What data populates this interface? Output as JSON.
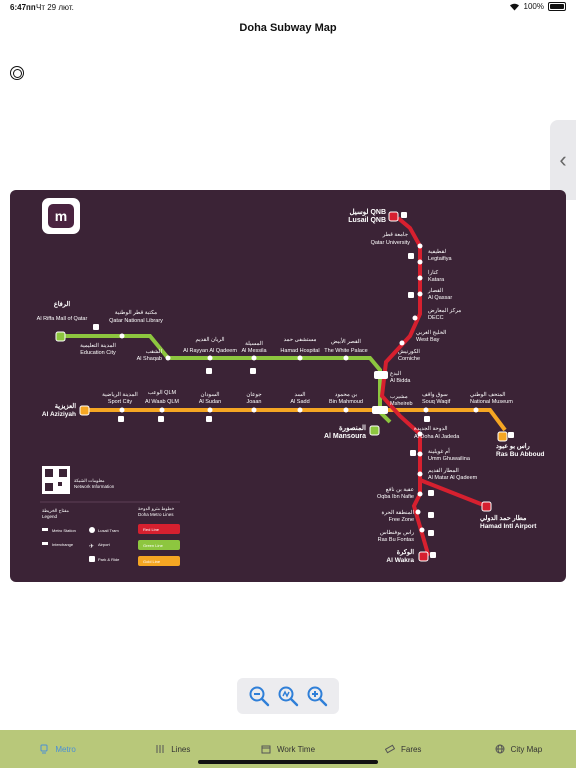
{
  "status": {
    "time": "6:47пп",
    "date": "Чт 29 лют.",
    "battery": "100%"
  },
  "header": {
    "title": "Doha Subway Map"
  },
  "side_tab": {
    "icon": "chevron-left-icon",
    "glyph": "‹"
  },
  "map": {
    "colors": {
      "background": "#3b2336",
      "red_line": "#d6202f",
      "green_line": "#8dc63f",
      "gold_line": "#f5a623",
      "station": "#ffffff"
    },
    "stations": {
      "lusail": "Lusail QNB",
      "lusail_ar": "لوسيل QNB",
      "qatar_university": "Qatar University",
      "qatar_university_ar": "جامعة قطر",
      "legtaifiya": "Legtaifiya",
      "legtaifiya_ar": "لقطيفية",
      "katara": "Katara",
      "katara_ar": "كتارا",
      "qassar": "Al Qassar",
      "qassar_ar": "القصار",
      "decc": "DECC",
      "decc_ar": "مركز المعارض",
      "west_bay": "West Bay",
      "west_bay_ar": "الخليج الغربي",
      "corniche": "Corniche",
      "corniche_ar": "الكورنيش",
      "al_bidda": "Al Bidda",
      "al_bidda_ar": "البدع",
      "msheireb": "Msheireb",
      "msheireb_ar": "مشيرب",
      "souq_waqif": "Souq Waqif",
      "souq_waqif_ar": "سوق واقف",
      "national_museum": "National Museum",
      "national_museum_ar": "المتحف الوطني",
      "ras_bu_abboud": "Ras Bu Abboud",
      "ras_bu_abboud_ar": "راس بو عبود",
      "al_doha_al_jadeda": "Al Doha Al Jadeda",
      "al_doha_al_jadeda_ar": "الدوحة الجديدة",
      "umm_ghuwailina": "Umm Ghuwailina",
      "umm_ghuwailina_ar": "أم غويلينة",
      "matar_qadeem": "Al Matar Al Qadeem",
      "matar_qadeem_ar": "المطار القديم",
      "oqba_ibn_nafie": "Oqba Ibn Nafie",
      "oqba_ibn_nafie_ar": "عقبة بن نافع",
      "free_zone": "Free Zone",
      "free_zone_ar": "المنطقة الحرة",
      "ras_bu_fontas": "Ras Bu Fontas",
      "ras_bu_fontas_ar": "راس بوفنطاس",
      "al_wakra": "Al Wakra",
      "al_wakra_ar": "الوكرة",
      "airport": "Hamad Intl Airport",
      "airport_ar": "مطار حمد الدولي",
      "al_mansoura": "Al Mansoura",
      "al_mansoura_ar": "المنصورة",
      "bin_mahmoud": "Bin Mahmoud",
      "bin_mahmoud_ar": "بن محمود",
      "al_sadd": "Al Sadd",
      "al_sadd_ar": "السد",
      "joaan": "Joaan",
      "joaan_ar": "جوعان",
      "al_sudan": "Al Sudan",
      "al_sudan_ar": "السودان",
      "al_waab": "Al Waab QLM",
      "al_waab_ar": "الوعب QLM",
      "sport_city": "Sport City",
      "sport_city_ar": "المدينة الرياضية",
      "al_aziziyah": "Al Aziziyah",
      "al_aziziyah_ar": "العزيزية",
      "the_white_palace": "The White Palace",
      "the_white_palace_ar": "القصر الأبيض",
      "hamad_hospital": "Hamad Hospital",
      "hamad_hospital_ar": "مستشفى حمد",
      "al_messila": "Al Messila",
      "al_messila_ar": "المسيلة",
      "al_rayyan_qadeem": "Al Rayyan Al Qadeem",
      "al_rayyan_qadeem_ar": "الريان القديم",
      "al_shaqab": "Al Shaqab",
      "al_shaqab_ar": "الشقب",
      "qatar_national_library": "Qatar National Library",
      "qatar_national_library_ar": "مكتبة قطر الوطنية",
      "education_city": "Education City",
      "education_city_ar": "المدينة التعليمية",
      "al_riffa": "Al Riffa Mall of Qatar",
      "al_riffa_ar": "الرفاع"
    },
    "legend": {
      "network_info": "Network Information",
      "network_info_ar": "معلومات الشبكة",
      "legend_title": "Legend",
      "legend_title_ar": "مفتاح الخريطة",
      "metro_lines": "Doha Metro Lines",
      "metro_lines_ar": "خطوط مترو الدوحة",
      "metro_station": "Metro Station",
      "interchange": "Interchange",
      "lusail_tram": "Lusail Tram",
      "airport": "Airport",
      "park_ride": "Park & Ride",
      "red_line": "Red Line",
      "green_line": "Green Line",
      "gold_line": "Gold Line"
    }
  },
  "zoom": {
    "zoom_out_icon": "zoom-out-icon",
    "zoom_reset_icon": "zoom-reset-icon",
    "zoom_in_icon": "zoom-in-icon"
  },
  "tabs": [
    {
      "label": "Metro",
      "icon": "train-icon",
      "active": true
    },
    {
      "label": "Lines",
      "icon": "lines-icon",
      "active": false
    },
    {
      "label": "Work Time",
      "icon": "calendar-icon",
      "active": false
    },
    {
      "label": "Fares",
      "icon": "ticket-icon",
      "active": false
    },
    {
      "label": "City Map",
      "icon": "globe-icon",
      "active": false
    }
  ]
}
